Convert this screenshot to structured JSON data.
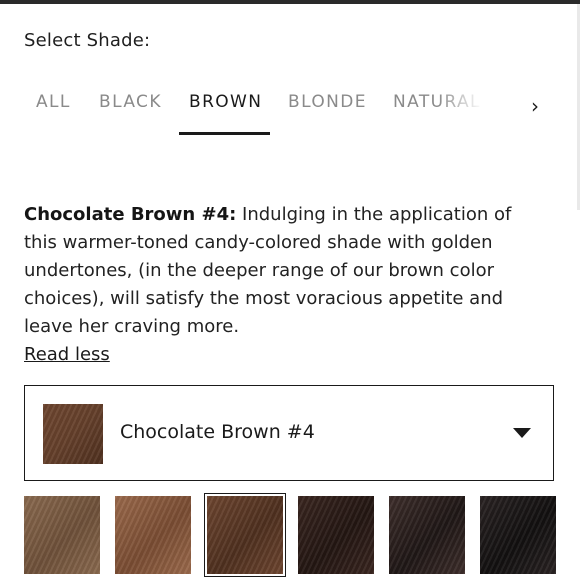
{
  "header": {
    "select_label": "Select Shade:"
  },
  "tabs": [
    {
      "label": "ALL",
      "active": false
    },
    {
      "label": "BLACK",
      "active": false
    },
    {
      "label": "BROWN",
      "active": true
    },
    {
      "label": "BLONDE",
      "active": false
    },
    {
      "label": "NATURAL",
      "active": false
    }
  ],
  "tabs_next_icon": "chevron-right-icon",
  "description": {
    "shade_name": "Chocolate Brown #4:",
    "text": " Indulging in the application of this warmer-toned candy-colored shade with golden undertones, (in the deeper range of our brown color choices), will satisfy the most voracious appetite and leave her craving more.",
    "read_less": "Read less"
  },
  "dropdown": {
    "selected_value": "Chocolate Brown #4",
    "caret_icon": "caret-down-icon",
    "swatch_color": "#65402b"
  },
  "swatches": [
    {
      "color_a": "#8a6a4f",
      "color_b": "#6f513a",
      "selected": false
    },
    {
      "color_a": "#9b6a4c",
      "color_b": "#7a4d33",
      "selected": false
    },
    {
      "color_a": "#6e4630",
      "color_b": "#4f301f",
      "selected": true
    },
    {
      "color_a": "#3a2620",
      "color_b": "#231612",
      "selected": false
    },
    {
      "color_a": "#3e2e2b",
      "color_b": "#1f1716",
      "selected": false
    },
    {
      "color_a": "#2a2323",
      "color_b": "#121010",
      "selected": false
    }
  ]
}
